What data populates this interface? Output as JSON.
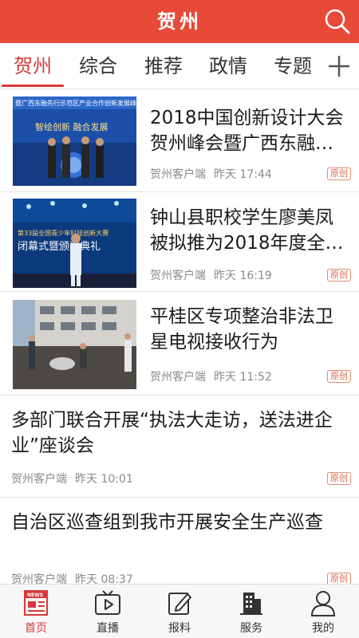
{
  "header": {
    "title": "贺州"
  },
  "tabs": [
    {
      "label": "贺州"
    },
    {
      "label": "综合"
    },
    {
      "label": "推荐"
    },
    {
      "label": "政情"
    },
    {
      "label": "专题"
    }
  ],
  "colors": {
    "brand": "#e84a3a",
    "accent": "#d8393a",
    "meta": "#8a8a8a"
  },
  "articles": [
    {
      "title": "2018中国创新设计大会贺州峰会暨广西东融…",
      "source": "贺州客户端",
      "time": "昨天 17:44",
      "badge": "原创"
    },
    {
      "title": "钟山县职校学生廖美凤被拟推为2018年度全…",
      "source": "贺州客户端",
      "time": "昨天 16:19",
      "badge": "原创"
    },
    {
      "title": "平桂区专项整治非法卫星电视接收行为",
      "source": "贺州客户端",
      "time": "昨天 11:52",
      "badge": "原创"
    },
    {
      "title": "多部门联合开展“执法大走访，送法进企业”座谈会",
      "source": "贺州客户端",
      "time": "昨天 10:01",
      "badge": "原创"
    },
    {
      "title": "自治区巡查组到我市开展安全生产巡查",
      "source": "贺州客户端",
      "time": "昨天 08:37",
      "badge": "原创"
    }
  ],
  "thumb_text": {
    "banner1": "暨广西东融先行示范区产业合作创新发展峰会",
    "slogan1": "智绘创新  融合发展",
    "banner2": "第33届全国青少年科技创新大赛",
    "banner2b": "闭幕式暨颁奖典礼"
  },
  "bottom_nav": [
    {
      "label": "首页",
      "icon": "news-icon"
    },
    {
      "label": "直播",
      "icon": "tv-icon"
    },
    {
      "label": "报料",
      "icon": "edit-icon"
    },
    {
      "label": "服务",
      "icon": "building-icon"
    },
    {
      "label": "我的",
      "icon": "person-icon"
    }
  ]
}
